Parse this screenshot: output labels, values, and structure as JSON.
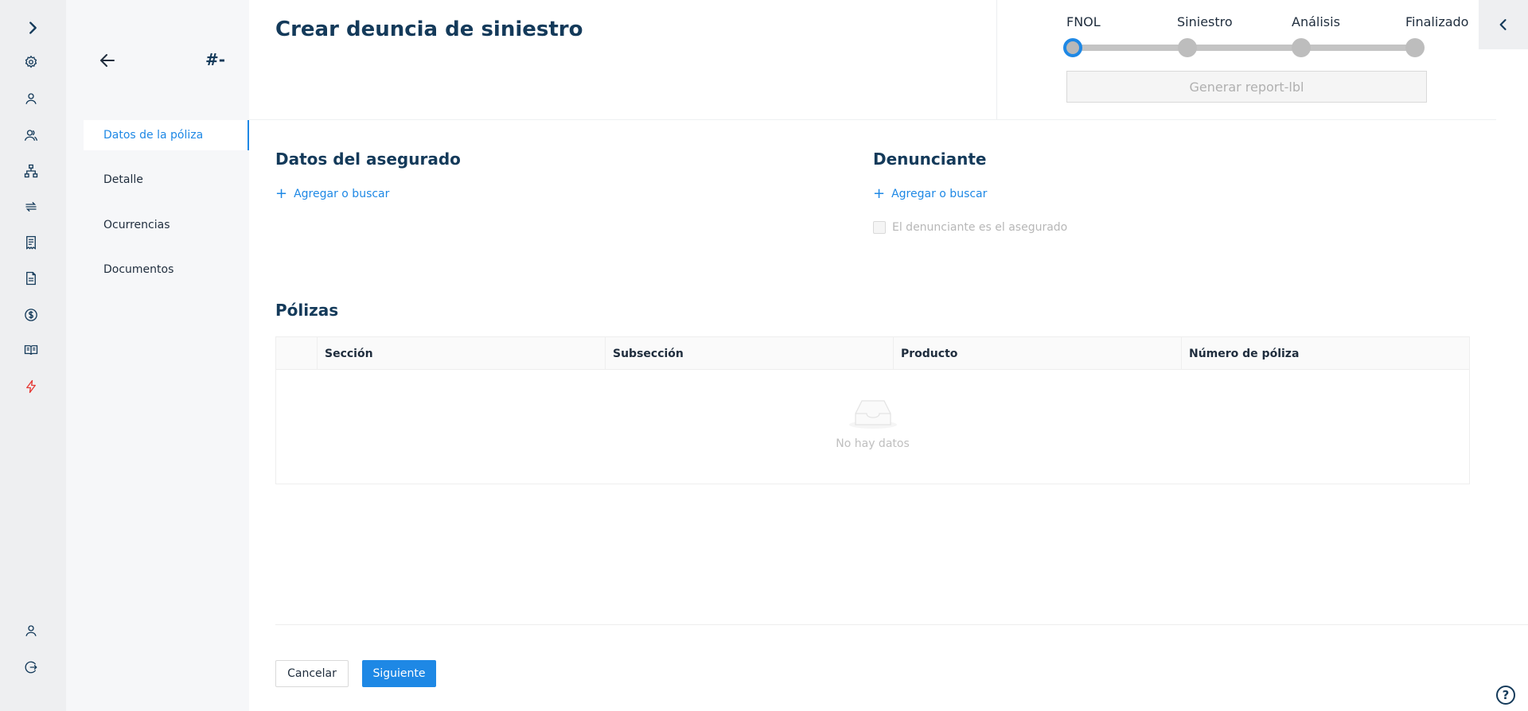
{
  "page": {
    "title": "Crear deuncia de siniestro"
  },
  "subnav": {
    "id_label": "#-",
    "items": [
      {
        "label": "Datos de la póliza",
        "active": true
      },
      {
        "label": "Detalle",
        "active": false
      },
      {
        "label": "Ocurrencias",
        "active": false
      },
      {
        "label": "Documentos",
        "active": false
      }
    ]
  },
  "rail": {
    "icons": [
      "gear-icon",
      "user-icon",
      "users-icon",
      "hierarchy-icon",
      "transfer-icon",
      "receipt-icon",
      "document-icon",
      "dollar-icon",
      "book-icon",
      "lightning-icon"
    ],
    "bottom_icons": [
      "user-icon",
      "logout-icon"
    ]
  },
  "stepper": {
    "steps": [
      "FNOL",
      "Siniestro",
      "Análisis",
      "Finalizado"
    ],
    "current": 0,
    "report_button": "Generar report-lbl"
  },
  "insured": {
    "title": "Datos del asegurado",
    "add_label": "Agregar o buscar"
  },
  "reporter": {
    "title": "Denunciante",
    "add_label": "Agregar o buscar",
    "same_as_insured_label": "El denunciante es el asegurado"
  },
  "policies": {
    "title": "Pólizas",
    "columns": [
      "Sección",
      "Subsección",
      "Producto",
      "Número de póliza"
    ],
    "empty_text": "No hay datos"
  },
  "footer": {
    "cancel_label": "Cancelar",
    "next_label": "Siguiente"
  },
  "help": {
    "label": "?"
  },
  "colors": {
    "primary": "#1e88e5",
    "heading": "#143a5a",
    "rail_bg": "#eeeff1",
    "subnav_bg": "#f6f7f9",
    "accent_red": "#e53935"
  }
}
